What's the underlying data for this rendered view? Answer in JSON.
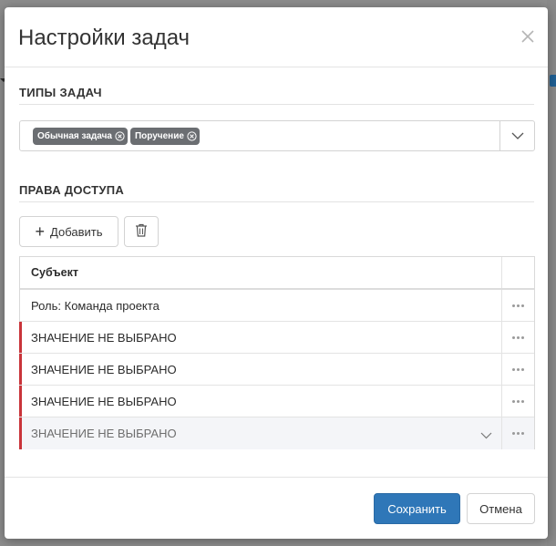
{
  "dialog": {
    "title": "Настройки задач",
    "close_icon": "close-icon"
  },
  "task_types": {
    "section_title": "ТИПЫ ЗАДАЧ",
    "chips": [
      {
        "label": "Обычная задача",
        "icon": "remove-circle-icon"
      },
      {
        "label": "Поручение",
        "icon": "remove-circle-icon"
      }
    ],
    "dropdown_icon": "chevron-down-icon"
  },
  "access_rights": {
    "section_title": "ПРАВА ДОСТУПА",
    "add_button_label": "Добавить",
    "add_icon": "plus-icon",
    "delete_icon": "trash-icon",
    "table": {
      "columns": [
        "Субъект"
      ],
      "rows": [
        {
          "subject": "Роль: Команда проекта",
          "invalid": false,
          "editing": false
        },
        {
          "subject": "ЗНАЧЕНИЕ НЕ ВЫБРАНО",
          "invalid": true,
          "editing": false
        },
        {
          "subject": "ЗНАЧЕНИЕ НЕ ВЫБРАНО",
          "invalid": true,
          "editing": false
        },
        {
          "subject": "ЗНАЧЕНИЕ НЕ ВЫБРАНО",
          "invalid": true,
          "editing": false
        },
        {
          "subject": "ЗНАЧЕНИЕ НЕ ВЫБРАНО",
          "invalid": true,
          "editing": true
        }
      ],
      "row_action_icon": "more-horizontal-icon"
    }
  },
  "footer": {
    "save_label": "Сохранить",
    "cancel_label": "Отмена"
  },
  "colors": {
    "primary": "#2f77b8",
    "chip_bg": "#6b6e72",
    "invalid_marker": "#c9343a"
  }
}
